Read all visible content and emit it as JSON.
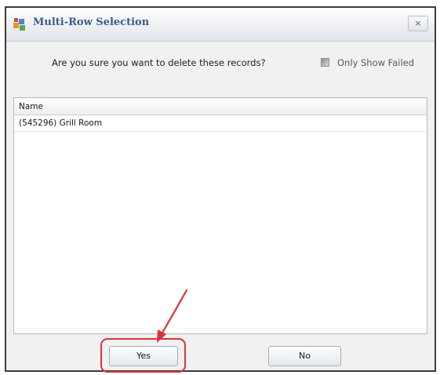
{
  "dialog": {
    "title": "Multi-Row Selection",
    "close_label": "×"
  },
  "prompt": {
    "question": "Are you sure you want to delete these records?",
    "only_show_failed_label": "Only Show Failed",
    "only_show_failed_checked": false
  },
  "grid": {
    "column_header": "Name",
    "rows": [
      "(545296) Grill Room"
    ]
  },
  "buttons": {
    "yes_label": "Yes",
    "no_label": "No"
  },
  "annotation": {
    "color": "#d9333a"
  }
}
